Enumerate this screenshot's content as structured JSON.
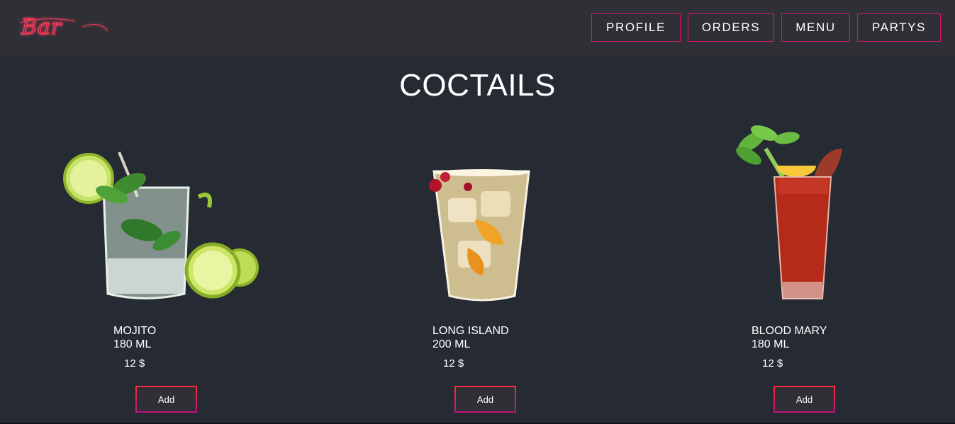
{
  "header": {
    "logo_text": "Bar",
    "nav": [
      {
        "label": "PROFILE"
      },
      {
        "label": "ORDERS"
      },
      {
        "label": "MENU"
      },
      {
        "label": "PARTYS"
      }
    ],
    "accent_color": "#d3186f",
    "logo_color": "#ff3b5c"
  },
  "main": {
    "title": "COCTAILS",
    "products": [
      {
        "name": "MOJITO",
        "volume": "180 ML",
        "price": "12 $",
        "button": "Add",
        "image_icon": "mojito-glass-icon"
      },
      {
        "name": "LONG ISLAND",
        "volume": "200 ML",
        "price": "12 $",
        "button": "Add",
        "image_icon": "long-island-glass-icon"
      },
      {
        "name": "BLOOD MARY",
        "volume": "180 ML",
        "price": "12 $",
        "button": "Add",
        "image_icon": "bloody-mary-glass-icon"
      }
    ]
  },
  "colors": {
    "background": "#262a33",
    "header_background": "#2e3036",
    "text": "#ffffff"
  }
}
